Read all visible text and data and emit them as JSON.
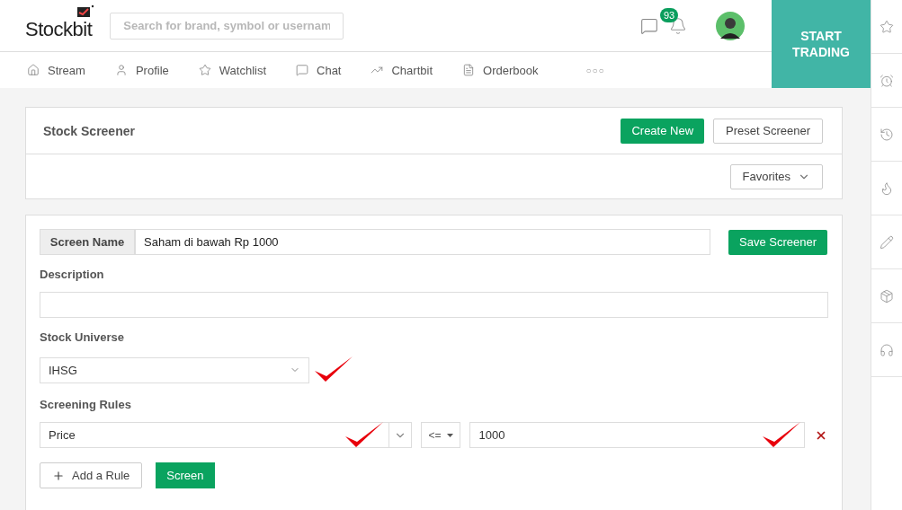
{
  "header": {
    "logo": "Stockbit",
    "search": {
      "placeholder": "Search for brand, symbol or usernam"
    },
    "notification_count": "93",
    "cta": "START TRADING"
  },
  "nav": [
    {
      "label": "Stream"
    },
    {
      "label": "Profile"
    },
    {
      "label": "Watchlist"
    },
    {
      "label": "Chat"
    },
    {
      "label": "Chartbit"
    },
    {
      "label": "Orderbook"
    },
    {
      "label": "○○○"
    }
  ],
  "screener": {
    "title": "Stock Screener",
    "buttons": [
      "Create New",
      "Preset Screener"
    ],
    "favorites": "Favorites"
  },
  "form": {
    "screen_name_label": "Screen Name",
    "screen_name": "Saham di bawah Rp 1000",
    "save": "Save Screener",
    "description_label": "Description",
    "universe_label": "Stock Universe",
    "universe": "IHSG",
    "rules_label": "Screening Rules",
    "rules": [
      {
        "field": "Price",
        "operator": "<=",
        "value": "1000"
      }
    ],
    "add_rule": "Add a Rule",
    "screen": "Screen"
  }
}
